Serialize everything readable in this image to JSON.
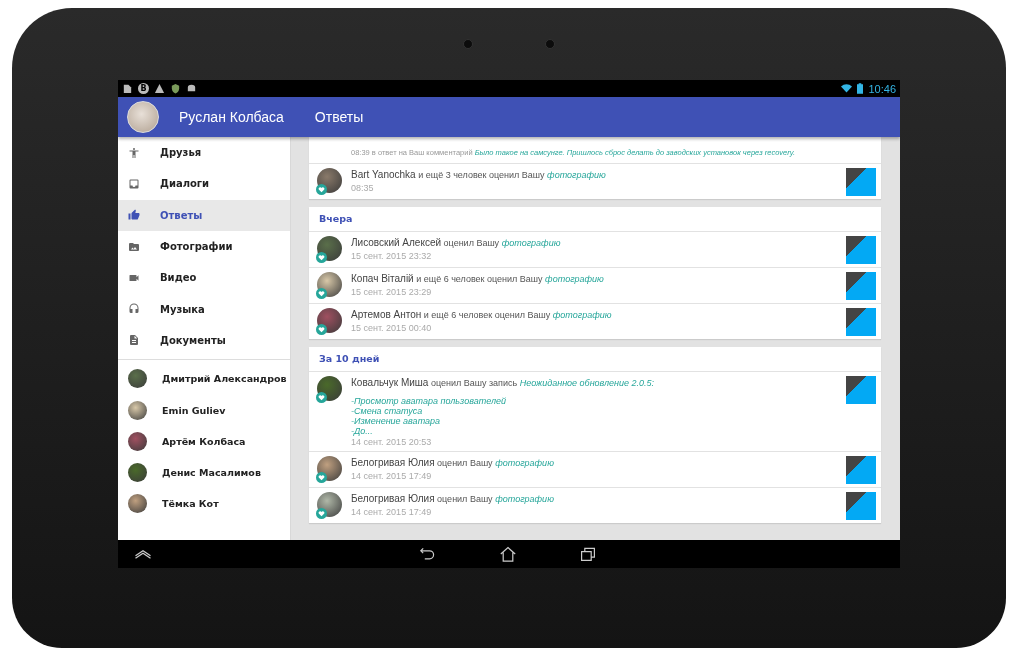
{
  "status_bar": {
    "notification_letter": "В",
    "time": "10:46"
  },
  "app_bar": {
    "user_name": "Руслан Колбаса",
    "title": "Ответы"
  },
  "menu": [
    {
      "label": "Друзья",
      "selected": false
    },
    {
      "label": "Диалоги",
      "selected": false
    },
    {
      "label": "Ответы",
      "selected": true
    },
    {
      "label": "Фотографии",
      "selected": false
    },
    {
      "label": "Видео",
      "selected": false
    },
    {
      "label": "Музыка",
      "selected": false
    },
    {
      "label": "Документы",
      "selected": false
    }
  ],
  "friends": [
    "Дмитрий Александров",
    "Emin Guliev",
    "Артём Колбаса",
    "Денис Масалимов",
    "Тёмка Кот"
  ],
  "feed": [
    {
      "items": [
        {
          "kind": "comment",
          "time": "08:39",
          "action": "в ответ на Ваш комментарий",
          "object": "Было такое на самсунге. Пришлось сброс делать до заводских установок через recovery."
        },
        {
          "kind": "like",
          "name": "Bart Yanochka",
          "action": "и ещё 3 человек оценил Вашу",
          "object": "фотографию",
          "time": "08:35"
        }
      ]
    },
    {
      "heading": "Вчера",
      "items": [
        {
          "kind": "like",
          "name": "Лисовский Алексей",
          "action": "оценил Вашу",
          "object": "фотографию",
          "time": "15 сент. 2015 23:32"
        },
        {
          "kind": "like",
          "name": "Копач Віталій",
          "action": "и ещё 6 человек оценил Вашу",
          "object": "фотографию",
          "time": "15 сент. 2015 23:29"
        },
        {
          "kind": "like",
          "name": "Артемов Антон",
          "action": "и ещё 6 человек оценил Вашу",
          "object": "фотографию",
          "time": "15 сент. 2015 00:40"
        }
      ]
    },
    {
      "heading": "За 10 дней",
      "items": [
        {
          "kind": "like",
          "name": "Ковальчук Миша",
          "action": "оценил Вашу запись",
          "object": "Неожиданное обновление 2.0.5:",
          "lines": [
            "-Просмотр аватара пользователей",
            "-Смена статуса",
            "-Изменение аватара",
            "-До..."
          ],
          "time": "14 сент. 2015 20:53"
        },
        {
          "kind": "like",
          "name": "Белогривая Юлия",
          "action": "оценил Вашу",
          "object": "фотографию",
          "time": "14 сент. 2015 17:49"
        },
        {
          "kind": "like",
          "name": "Белогривая Юлия",
          "action": "оценил Вашу",
          "object": "фотографию",
          "time": "14 сент. 2015 17:49"
        }
      ]
    }
  ]
}
